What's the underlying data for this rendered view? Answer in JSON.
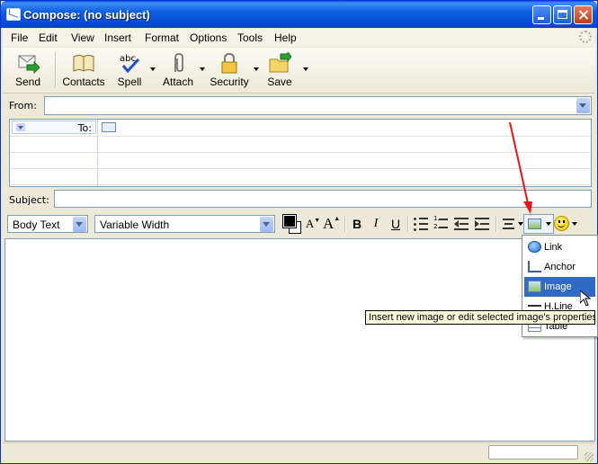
{
  "window": {
    "title": "Compose: (no subject)"
  },
  "menu": {
    "items": [
      "File",
      "Edit",
      "View",
      "Insert",
      "Format",
      "Options",
      "Tools",
      "Help"
    ],
    "accels": [
      "F",
      "E",
      "V",
      "I",
      "o",
      "p",
      "T",
      "H"
    ]
  },
  "toolbar": {
    "buttons": [
      {
        "label": "Send",
        "icon": "send-icon"
      },
      {
        "label": "Contacts",
        "icon": "contacts-book-icon"
      },
      {
        "label": "Spell",
        "icon": "spellcheck-icon",
        "has_dropdown": true
      },
      {
        "label": "Attach",
        "icon": "paperclip-icon",
        "has_dropdown": true
      },
      {
        "label": "Security",
        "icon": "padlock-icon",
        "has_dropdown": true
      },
      {
        "label": "Save",
        "icon": "save-folder-icon",
        "has_dropdown": true
      }
    ]
  },
  "address": {
    "from_label": "From:",
    "from_value": "",
    "to_label": "To:",
    "subject_label": "Subject:",
    "subject_value": ""
  },
  "format": {
    "paragraph_style": "Body Text",
    "font": "Variable Width",
    "bold": "B",
    "italic": "I",
    "underline": "U",
    "text_color": "#000000",
    "background_color": "#ffffff",
    "smaller_font": "A",
    "larger_font": "A"
  },
  "insert_menu": {
    "items": [
      {
        "label": "Link",
        "icon": "globe-link-icon"
      },
      {
        "label": "Anchor",
        "icon": "anchor-icon"
      },
      {
        "label": "Image",
        "icon": "image-icon",
        "highlighted": true
      },
      {
        "label": "H.Line",
        "icon": "horizontal-line-icon"
      },
      {
        "label": "Table",
        "icon": "table-icon"
      }
    ]
  },
  "tooltip": {
    "text": "Insert new image or edit selected image's properties"
  },
  "colors": {
    "title_bar": "#0a5bdc",
    "menu_highlight": "#316ac5",
    "annotation_arrow": "#e8141b",
    "tooltip_bg": "#ffffe1"
  }
}
